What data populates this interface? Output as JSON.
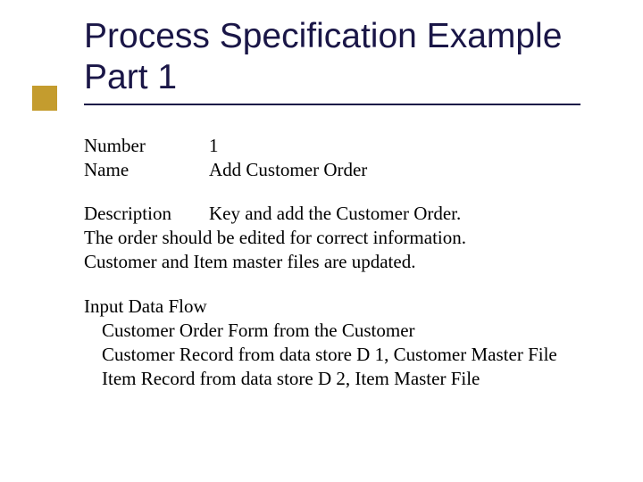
{
  "title": {
    "line1": "Process Specification Example",
    "line2": "Part 1"
  },
  "fields": {
    "number_label": "Number",
    "number_value": "1",
    "name_label": "Name",
    "name_value": "Add Customer Order"
  },
  "description": {
    "label": "Description",
    "first_line_after_label": "Key and add the Customer Order.",
    "line2": "The order should be edited for correct information.",
    "line3": "Customer and Item master files are updated."
  },
  "input_flow": {
    "heading": "Input Data Flow",
    "items": [
      "Customer Order Form from the Customer",
      "Customer Record from data store D 1,  Customer Master File",
      "Item Record from data store D 2, Item Master  File"
    ]
  }
}
